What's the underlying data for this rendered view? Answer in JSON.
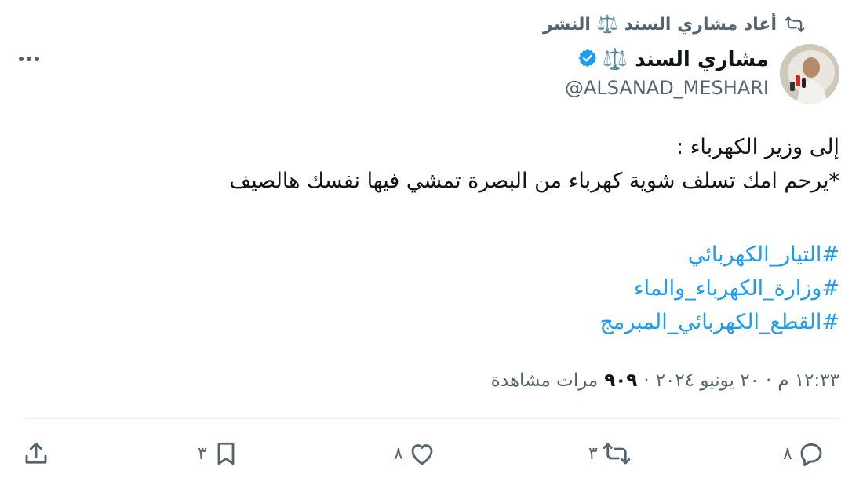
{
  "retweet_context": {
    "text": "أعاد مشاري السند ⚖️ النشر",
    "icon": "retweet-icon"
  },
  "author": {
    "name": "مشاري السند ⚖️",
    "handle": "@ALSANAD_MESHARI",
    "verified_icon": "verified-badge-icon",
    "accent_color": "#1d9bf0"
  },
  "tweet": {
    "lines": [
      "إلى وزير الكهرباء :",
      "*يرحم امك تسلف شوية كهرباء من البصرة تمشي فيها نفسك هالصيف"
    ],
    "hashtags": [
      "#التيار_الكهربائي",
      "#وزارة_الكهرباء_والماء",
      "#القطع_الكهربائي_المبرمج"
    ]
  },
  "meta": {
    "time": "١٢:٣٣ م",
    "separator": "·",
    "date": "٢٠ يونيو ٢٠٢٤",
    "views_count": "٩٠٩",
    "views_label": "مرات مشاهدة"
  },
  "actions": {
    "reply_count": "٨",
    "retweet_count": "٣",
    "like_count": "٨",
    "bookmark_count": "٣"
  },
  "colors": {
    "text_primary": "#0f1419",
    "text_secondary": "#536471",
    "link": "#1d9bf0",
    "divider": "#eff3f4"
  }
}
